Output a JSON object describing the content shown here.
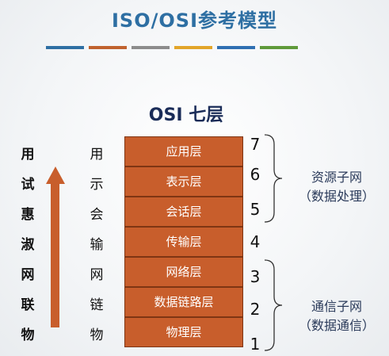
{
  "title": "ISO/OSI参考模型",
  "color_bars": [
    "#2e6fa3",
    "#c0622e",
    "#8c8c8c",
    "#e2a52a",
    "#2f6fb2",
    "#5f9a3a"
  ],
  "osi_heading": "OSI  七层",
  "left_chars": [
    "用",
    "试",
    "惠",
    "淑",
    "网",
    "联",
    "物"
  ],
  "mid_chars": [
    "用",
    "示",
    "会",
    "输",
    "网",
    "链",
    "物"
  ],
  "layers": [
    {
      "name": "应用层",
      "num": "7"
    },
    {
      "name": "表示层",
      "num": "6"
    },
    {
      "name": "会话层",
      "num": "5"
    },
    {
      "name": "传输层",
      "num": "4"
    },
    {
      "name": "网络层",
      "num": "3"
    },
    {
      "name": "数据链路层",
      "num": "2"
    },
    {
      "name": "物理层",
      "num": "1"
    }
  ],
  "groups": {
    "upper": {
      "line1": "资源子网",
      "line2": "（数据处理）"
    },
    "lower": {
      "line1": "通信子网",
      "line2": "（数据通信）"
    }
  }
}
